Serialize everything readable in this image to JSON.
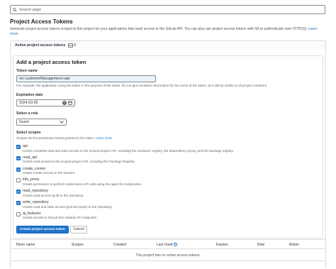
{
  "search": {
    "placeholder": "Search page"
  },
  "page": {
    "title": "Project Access Tokens",
    "description": "Generate project access tokens scoped to this project for your applications that need access to the GitLab API. You can also use project access tokens with Git to authenticate over HTTP(S).",
    "learn_more": "Learn more."
  },
  "active_tokens": {
    "title": "Active project access tokens",
    "count": "0"
  },
  "form": {
    "heading": "Add a project access token",
    "token_name": {
      "label": "Token name",
      "value": "mc-customerManagement-sapi",
      "help": "For example, the application using the token or the purpose of the token. Do not give sensitive information for the name of the token, as it will be visible to all project members."
    },
    "expiration": {
      "label": "Expiration date",
      "value": "2024-03-26"
    },
    "role": {
      "label": "Select a role",
      "value": "Guest"
    },
    "scopes": {
      "label": "Select scopes",
      "help": "Scopes set the permission levels granted to the token.",
      "learn_more": "Learn more.",
      "items": [
        {
          "name": "api",
          "checked": true,
          "desc": "Grants complete read and write access to the scoped project API, including the container registry, the dependency proxy, and the package registry."
        },
        {
          "name": "read_api",
          "checked": true,
          "desc": "Grants read access to the scoped project API, including the Package Registry."
        },
        {
          "name": "create_runner",
          "checked": true,
          "desc": "Grants create access to the runners."
        },
        {
          "name": "k8s_proxy",
          "checked": false,
          "desc": "Grants permission to perform Kubernetes API calls using the agent for Kubernetes."
        },
        {
          "name": "read_repository",
          "checked": true,
          "desc": "Grants read access (pull) to the repository."
        },
        {
          "name": "write_repository",
          "checked": true,
          "desc": "Grants read and write access (pull and push) to the repository."
        },
        {
          "name": "ai_features",
          "checked": false,
          "desc": "Grants access to GitLab Duo related API endpoints."
        }
      ]
    },
    "create_button": "Create project access token",
    "cancel_button": "Cancel"
  },
  "table": {
    "columns": [
      "Token name",
      "Scopes",
      "Created",
      "Last Used",
      "Expires",
      "Role",
      "Action"
    ],
    "last_used_help": "?",
    "empty": "This project has no active access tokens."
  },
  "colors": {
    "primary": "#1f75cb",
    "border": "#dcdcde",
    "input_highlight": "#e9f3fc"
  }
}
